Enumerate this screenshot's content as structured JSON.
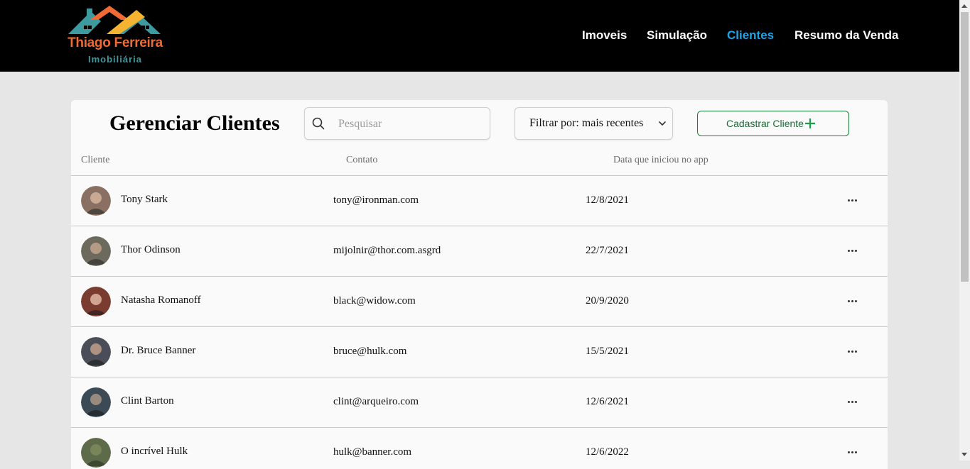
{
  "brand": {
    "name": "Thiago Ferreira",
    "subtitle": "Imobiliária",
    "colors": {
      "orange": "#f06a35",
      "teal": "#3d9aa0",
      "yellow": "#f5b332"
    }
  },
  "nav": {
    "items": [
      {
        "label": "Imoveis",
        "active": false
      },
      {
        "label": "Simulação",
        "active": false
      },
      {
        "label": "Clientes",
        "active": true
      },
      {
        "label": "Resumo da Venda",
        "active": false
      }
    ],
    "active_color": "#1ea5e8"
  },
  "page": {
    "title": "Gerenciar Clientes",
    "search": {
      "placeholder": "Pesquisar",
      "value": "",
      "icon": "search-icon"
    },
    "filter": {
      "label": "Filtrar por: mais recentes",
      "icon": "chevron-down-icon"
    },
    "add_button": {
      "label": "Cadastrar Cliente",
      "icon": "plus-icon",
      "accent": "#1b7a3a"
    }
  },
  "table": {
    "headers": {
      "client": "Cliente",
      "contact": "Contato",
      "date": "Data que iniciou no app"
    },
    "rows": [
      {
        "name": "Tony Stark",
        "email": "tony@ironman.com",
        "date": "12/8/2021",
        "avatar_color": "#8a7062"
      },
      {
        "name": "Thor Odinson",
        "email": "mijolnir@thor.com.asgrd",
        "date": "22/7/2021",
        "avatar_color": "#6c6a5c"
      },
      {
        "name": "Natasha Romanoff",
        "email": "black@widow.com",
        "date": "20/9/2020",
        "avatar_color": "#7a3b30"
      },
      {
        "name": "Dr. Bruce Banner",
        "email": "bruce@hulk.com",
        "date": "15/5/2021",
        "avatar_color": "#4a4e58"
      },
      {
        "name": "Clint Barton",
        "email": "clint@arqueiro.com",
        "date": "12/6/2021",
        "avatar_color": "#3b4a55"
      },
      {
        "name": "O incrível Hulk",
        "email": "hulk@banner.com",
        "date": "12/6/2022",
        "avatar_color": "#5e6b4a"
      }
    ]
  }
}
